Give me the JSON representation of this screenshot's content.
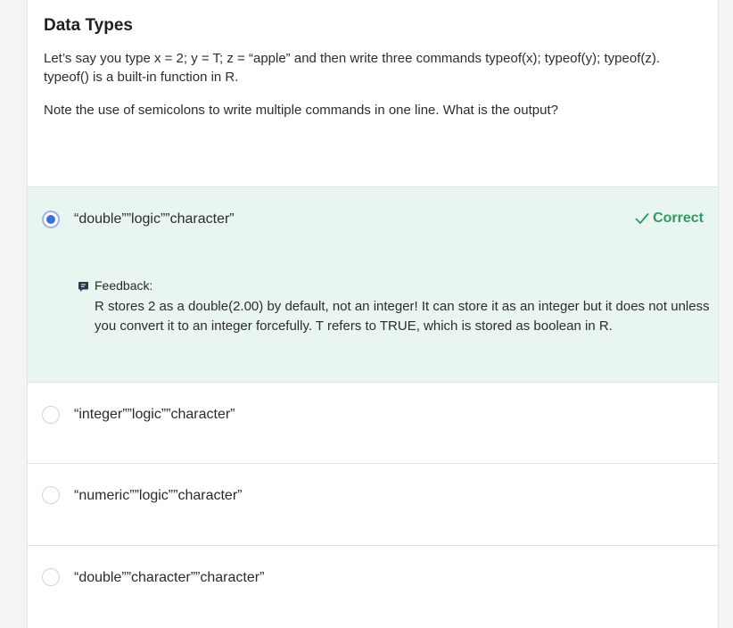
{
  "question": {
    "title": "Data Types",
    "text": "Let’s say you type x = 2; y = T; z = “apple” and then write three commands typeof(x); typeof(y); typeof(z). typeof() is a built-in function in R.",
    "note": "Note the use of semicolons to write multiple commands in one line. What is the output?"
  },
  "options": [
    {
      "label": "“double””logic””character”",
      "selected": true
    },
    {
      "label": "“integer””logic””character”",
      "selected": false
    },
    {
      "label": "“numeric””logic””character”",
      "selected": false
    },
    {
      "label": "“double””character””character”",
      "selected": false
    }
  ],
  "result": {
    "correct_label": "Correct",
    "icon": "check-icon"
  },
  "feedback": {
    "title": "Feedback:",
    "text": "R stores 2 as a double(2.00) by default, not an integer! It can store it as an integer but it does not unless you convert it to an integer forcefully. T refers to TRUE, which is stored as boolean in R.",
    "icon": "comment-icon"
  },
  "colors": {
    "selected_bg": "#e9f5f1",
    "correct": "#2e9a62",
    "radio_selected": "#3d6fd8"
  }
}
